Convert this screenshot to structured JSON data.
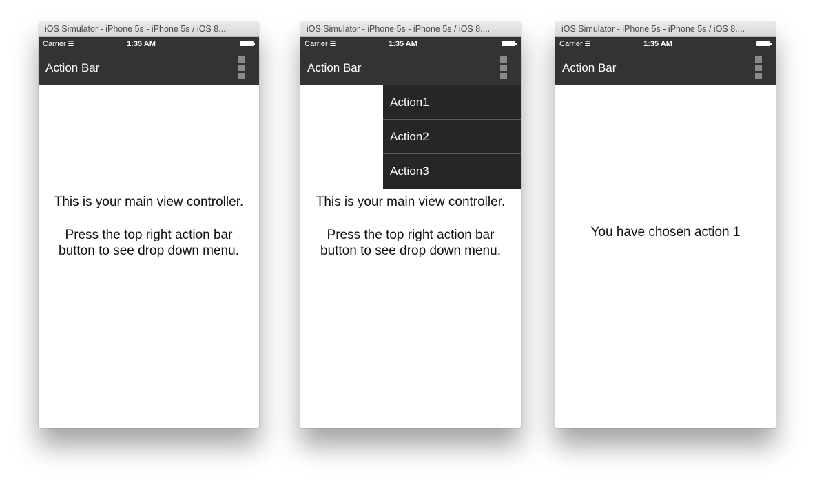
{
  "windows": [
    {
      "title": "iOS Simulator - iPhone 5s - iPhone 5s / iOS 8....",
      "status": {
        "carrier": "Carrier",
        "time": "1:35 AM"
      },
      "action_bar": {
        "title": "Action Bar"
      },
      "main_text": {
        "line1": "This is your main view controller.",
        "line2": "Press the top right action bar button to see drop down menu."
      }
    },
    {
      "title": "iOS Simulator - iPhone 5s - iPhone 5s / iOS 8....",
      "status": {
        "carrier": "Carrier",
        "time": "1:35 AM"
      },
      "action_bar": {
        "title": "Action Bar"
      },
      "dropdown": [
        "Action1",
        "Action2",
        "Action3"
      ],
      "main_text": {
        "line1": "This is your main view controller.",
        "line2": "Press the top right action bar button to see drop down menu."
      }
    },
    {
      "title": "iOS Simulator - iPhone 5s - iPhone 5s / iOS 8....",
      "status": {
        "carrier": "Carrier",
        "time": "1:35 AM"
      },
      "action_bar": {
        "title": "Action Bar"
      },
      "main_text": {
        "line1": "You have chosen action 1"
      }
    }
  ],
  "icons": {
    "wifi": "wifi-icon",
    "battery": "battery-icon",
    "overflow": "overflow-menu-icon"
  }
}
